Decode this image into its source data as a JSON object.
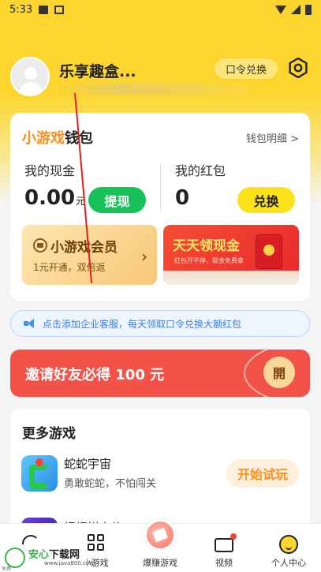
{
  "status_bar": {
    "time": "5:33"
  },
  "profile": {
    "username": "乐享趣盒...",
    "password_button": "口令兑换"
  },
  "wallet": {
    "title_highlight": "小游戏",
    "title_rest": "钱包",
    "detail_link": "钱包明细 >",
    "cash_label": "我的现金",
    "cash_value": "0.00",
    "cash_unit": "元",
    "withdraw_button": "提现",
    "redpacket_label": "我的红包",
    "redpacket_value": "0",
    "exchange_button": "兑换",
    "vip": {
      "title": "小游戏会员",
      "subtitle": "1元开通，双倍返",
      "arrow": "›"
    },
    "cash_banner": {
      "title": "天天领现金",
      "subtitle": "红包开不停，现金免费拿"
    }
  },
  "notice": {
    "text": "点击添加企业客服，每天领取口令兑换大额红包"
  },
  "invite": {
    "text": "邀请好友必得 100 元",
    "open_button": "開"
  },
  "more_games": {
    "title": "更多游戏",
    "games": [
      {
        "name": "蛇蛇宇宙",
        "desc": "勇敢蛇蛇，不怕闯关",
        "button": "开始试玩"
      },
      {
        "name": "螺螺拼上旅"
      }
    ]
  },
  "tabbar": {
    "tabs": [
      {
        "label": ""
      },
      {
        "label": "小游戏"
      },
      {
        "label": "爆赚游戏"
      },
      {
        "label": "视频"
      },
      {
        "label": "个人中心"
      }
    ]
  },
  "watermark": {
    "prefix": "安心",
    "suffix": "下载网",
    "url": "www.java800.com",
    "small": "免费"
  },
  "colors": {
    "brand_yellow": "#fcd62e",
    "accent_orange": "#ff8d1a",
    "green_button": "#19c15a",
    "invite_red": "#f25248",
    "notice_blue": "#3d7fdc"
  }
}
